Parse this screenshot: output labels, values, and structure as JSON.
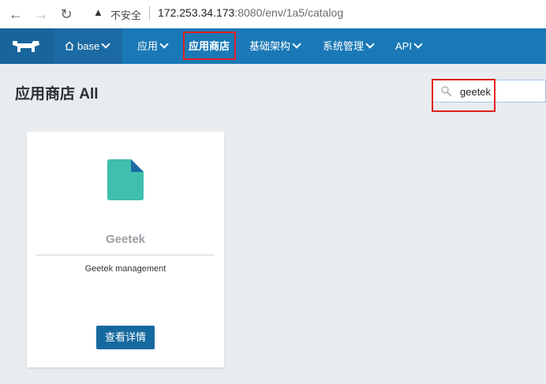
{
  "browser": {
    "insecure_label": "不安全",
    "url_host": "172.253.34.173",
    "url_path": ":8080/env/1a5/catalog"
  },
  "topnav": {
    "env_label": "base",
    "items": [
      {
        "label": "应用"
      },
      {
        "label": "应用商店"
      },
      {
        "label": "基础架构"
      },
      {
        "label": "系统管理"
      },
      {
        "label": "API"
      }
    ]
  },
  "page": {
    "title": "应用商店 All"
  },
  "search": {
    "value": "geetek"
  },
  "catalog": {
    "cards": [
      {
        "title": "Geetek",
        "description": "Geetek management",
        "button_label": "查看详情"
      }
    ]
  },
  "colors": {
    "nav_bg": "#1a78b6",
    "logo_bg": "#17659b",
    "highlight_box": "#e02020",
    "file_icon": "#3fbfae",
    "file_fold": "#1b6aa3",
    "button_bg": "#16699f"
  }
}
